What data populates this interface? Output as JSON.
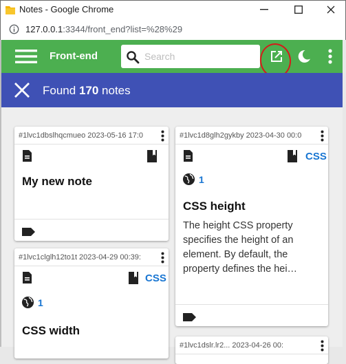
{
  "window": {
    "title": "Notes - Google Chrome"
  },
  "browser": {
    "url_host": "127.0.0.1",
    "url_rest": ":3344/front_end?list=%28%29"
  },
  "appbar": {
    "brand": "Front-end",
    "search_placeholder": "Search",
    "color": "#4caf50"
  },
  "results": {
    "prefix": "Found",
    "count": "170",
    "suffix": "notes",
    "color": "#3f51b5"
  },
  "notes": [
    {
      "id_date": "#1lvc1dbslhqcmueo 2023-05-16 17:0",
      "category": "",
      "link_count": "",
      "title": "My new note",
      "body": ""
    },
    {
      "id_date": "#1lvc1d8glh2gykby 2023-04-30 00:0",
      "category": "CSS",
      "link_count": "1",
      "title": "CSS height",
      "body": "The height CSS property specifies the height of an element. By default, the property defines the hei…"
    },
    {
      "id_date": "#1lvc1clglh12to1t 2023-04-29 00:39:",
      "category": "CSS",
      "link_count": "1",
      "title": "CSS width",
      "body": ""
    },
    {
      "id_date": "#1lvc1dslr.lr2... 2023-04-26 00:",
      "category": "",
      "link_count": "",
      "title": "",
      "body": ""
    }
  ]
}
